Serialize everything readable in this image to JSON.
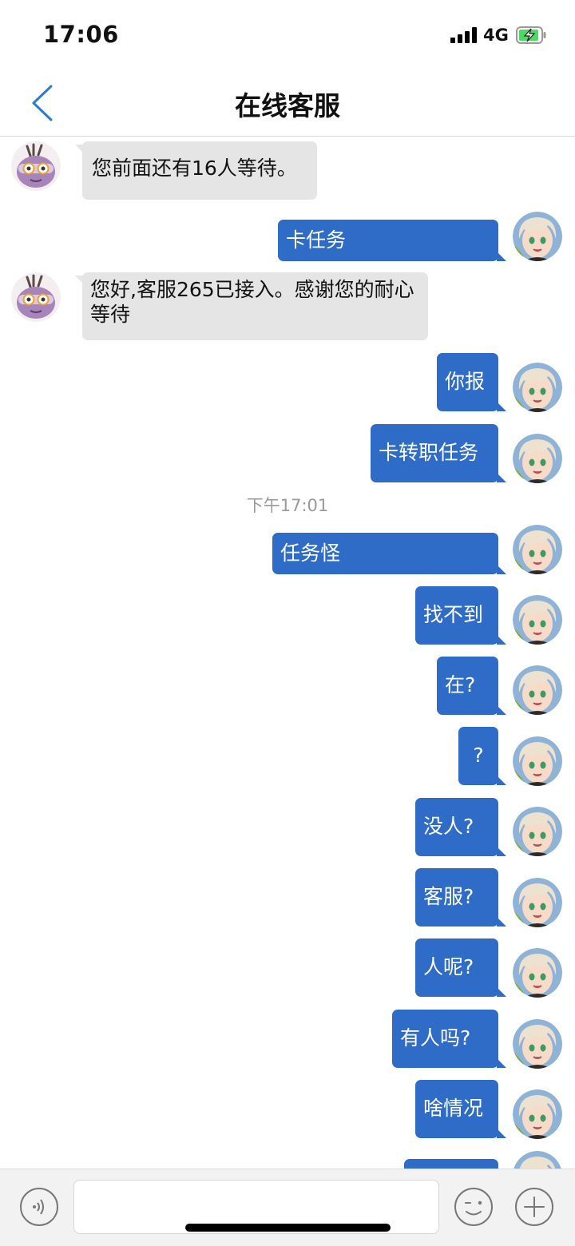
{
  "status_bar": {
    "time": "17:06",
    "network": "4G"
  },
  "header": {
    "title": "在线客服"
  },
  "messages": [
    {
      "text": "您前面还有16人等待。"
    },
    {
      "text": "卡任务"
    },
    {
      "text": "您好,客服265已接入。感谢您的耐心等待"
    },
    {
      "text": "你报"
    },
    {
      "text": "卡转职任务"
    },
    {
      "text": "下午17:01"
    },
    {
      "text": "任务怪"
    },
    {
      "text": "找不到"
    },
    {
      "text": "在?"
    },
    {
      "text": "?"
    },
    {
      "text": "没人?"
    },
    {
      "text": "客服?"
    },
    {
      "text": "人呢?"
    },
    {
      "text": "有人吗?"
    },
    {
      "text": "啥情况"
    }
  ],
  "input_bar": {
    "message_value": "",
    "placeholder": ""
  },
  "colors": {
    "outgoing_bubble": "#2e6cc7",
    "incoming_bubble": "#e5e5e5",
    "nav_back": "#2d7bd1"
  }
}
